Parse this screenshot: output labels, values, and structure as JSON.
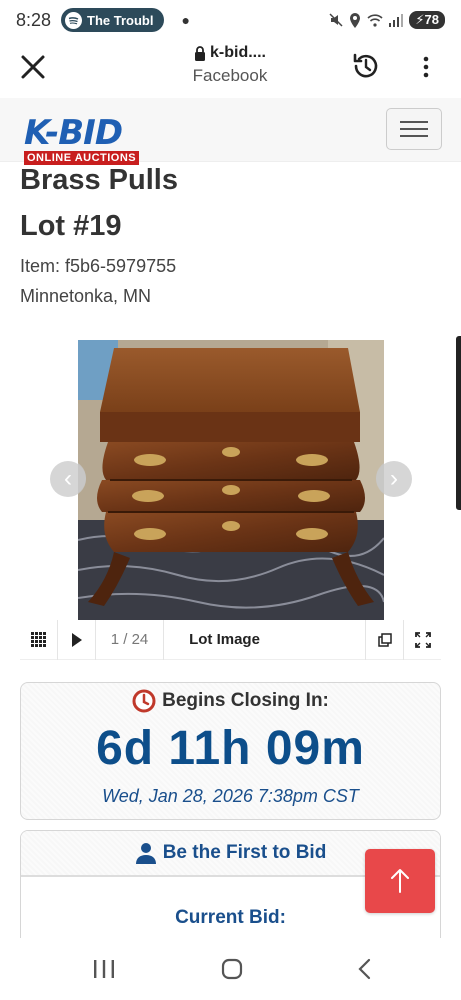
{
  "status_bar": {
    "time": "8:28",
    "media_app": "The Troubl",
    "battery": "78",
    "icons": [
      "spotify-icon",
      "mute-icon",
      "location-icon",
      "wifi-icon",
      "signal-icon",
      "battery-icon"
    ]
  },
  "browser": {
    "url": "k-bid....",
    "source": "Facebook",
    "icons": [
      "close-icon",
      "lock-icon",
      "history-icon",
      "more-vert-icon"
    ]
  },
  "site": {
    "logo_main": "K-BID",
    "logo_sub": "ONLINE AUCTIONS",
    "icons": [
      "hamburger-menu-icon"
    ]
  },
  "lot": {
    "title": "Brass Pulls",
    "number": "Lot #19",
    "item_id": "Item: f5b6-5979755",
    "location": "Minnetonka, MN"
  },
  "gallery": {
    "counter": "1 / 24",
    "label": "Lot Image",
    "icons": [
      "grid-icon",
      "play-icon",
      "popout-icon",
      "fullscreen-icon",
      "chevron-left-icon",
      "chevron-right-icon"
    ]
  },
  "closing": {
    "heading": "Begins Closing In:",
    "countdown": "6d 11h 09m",
    "date": "Wed, Jan 28, 2026 7:38pm CST",
    "icons": [
      "clock-icon"
    ]
  },
  "bid": {
    "heading": "Be the First to Bid",
    "current_label": "Current Bid:",
    "icons": [
      "person-icon",
      "arrow-up-icon"
    ]
  },
  "colors": {
    "brand_blue": "#1f5fb3",
    "brand_red": "#c81e1e",
    "countdown_blue": "#0d4e8a",
    "scroll_button_red": "#e8484a"
  }
}
